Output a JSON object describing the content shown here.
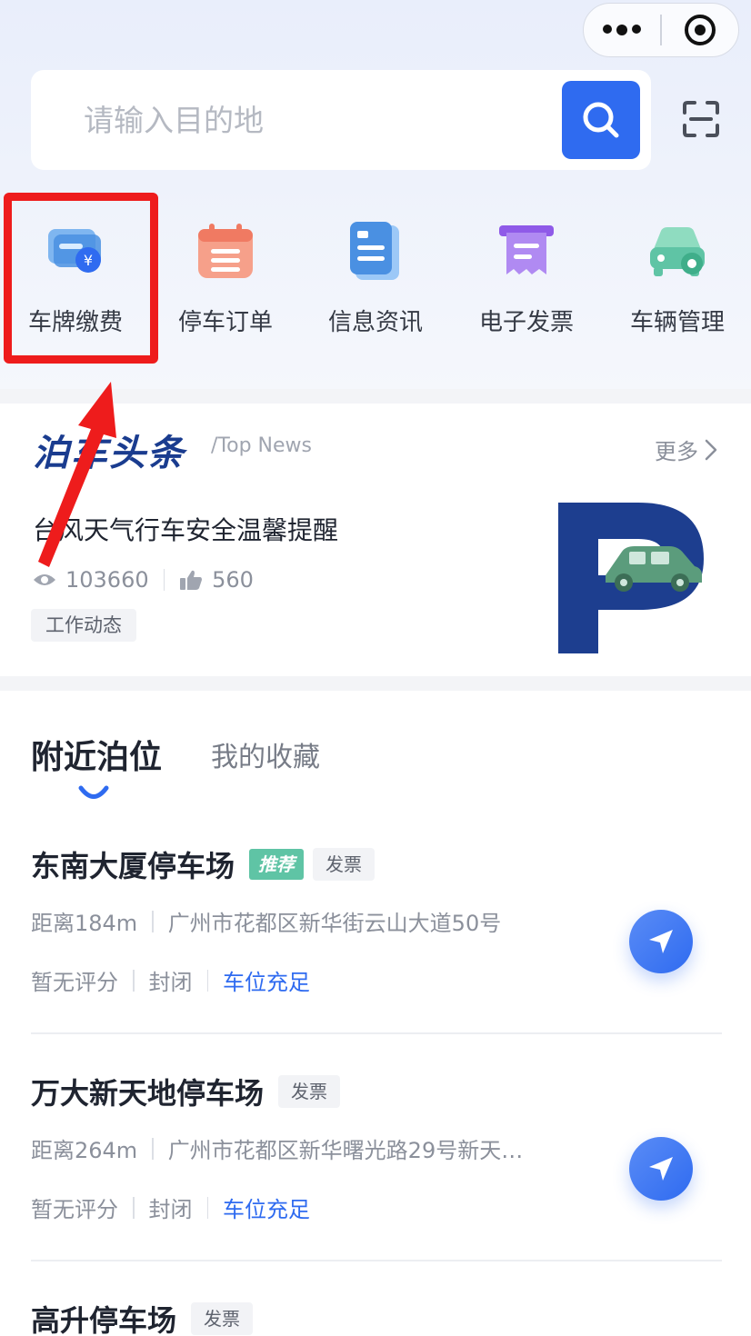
{
  "search": {
    "placeholder": "请输入目的地"
  },
  "quick_entries": [
    {
      "label": "车牌缴费",
      "icon": "payment-card-icon"
    },
    {
      "label": "停车订单",
      "icon": "order-calendar-icon"
    },
    {
      "label": "信息资讯",
      "icon": "news-document-icon"
    },
    {
      "label": "电子发票",
      "icon": "invoice-icon"
    },
    {
      "label": "车辆管理",
      "icon": "car-settings-icon"
    }
  ],
  "news": {
    "section_title": "泊车头条",
    "section_subtitle": "/Top News",
    "more_label": "更多",
    "headline": "台风天气行车安全温馨提醒",
    "views": "103660",
    "likes": "560",
    "tag": "工作动态"
  },
  "tabs": {
    "active": "附近泊位",
    "inactive": "我的收藏"
  },
  "parking_lots": [
    {
      "name": "东南大厦停车场",
      "recommend_badge": "推荐",
      "invoice_badge": "发票",
      "distance": "距离184m",
      "address": "广州市花都区新华街云山大道50号",
      "rating": "暂无评分",
      "status": "封闭",
      "availability": "车位充足"
    },
    {
      "name": "万大新天地停车场",
      "invoice_badge": "发票",
      "distance": "距离264m",
      "address": "广州市花都区新华曙光路29号新天…",
      "rating": "暂无评分",
      "status": "封闭",
      "availability": "车位充足"
    },
    {
      "name": "高升停车场",
      "invoice_badge": "发票"
    }
  ],
  "colors": {
    "primary": "#2f6bf0",
    "highlight": "#ee1c1c",
    "recommend": "#5fc4a5"
  }
}
